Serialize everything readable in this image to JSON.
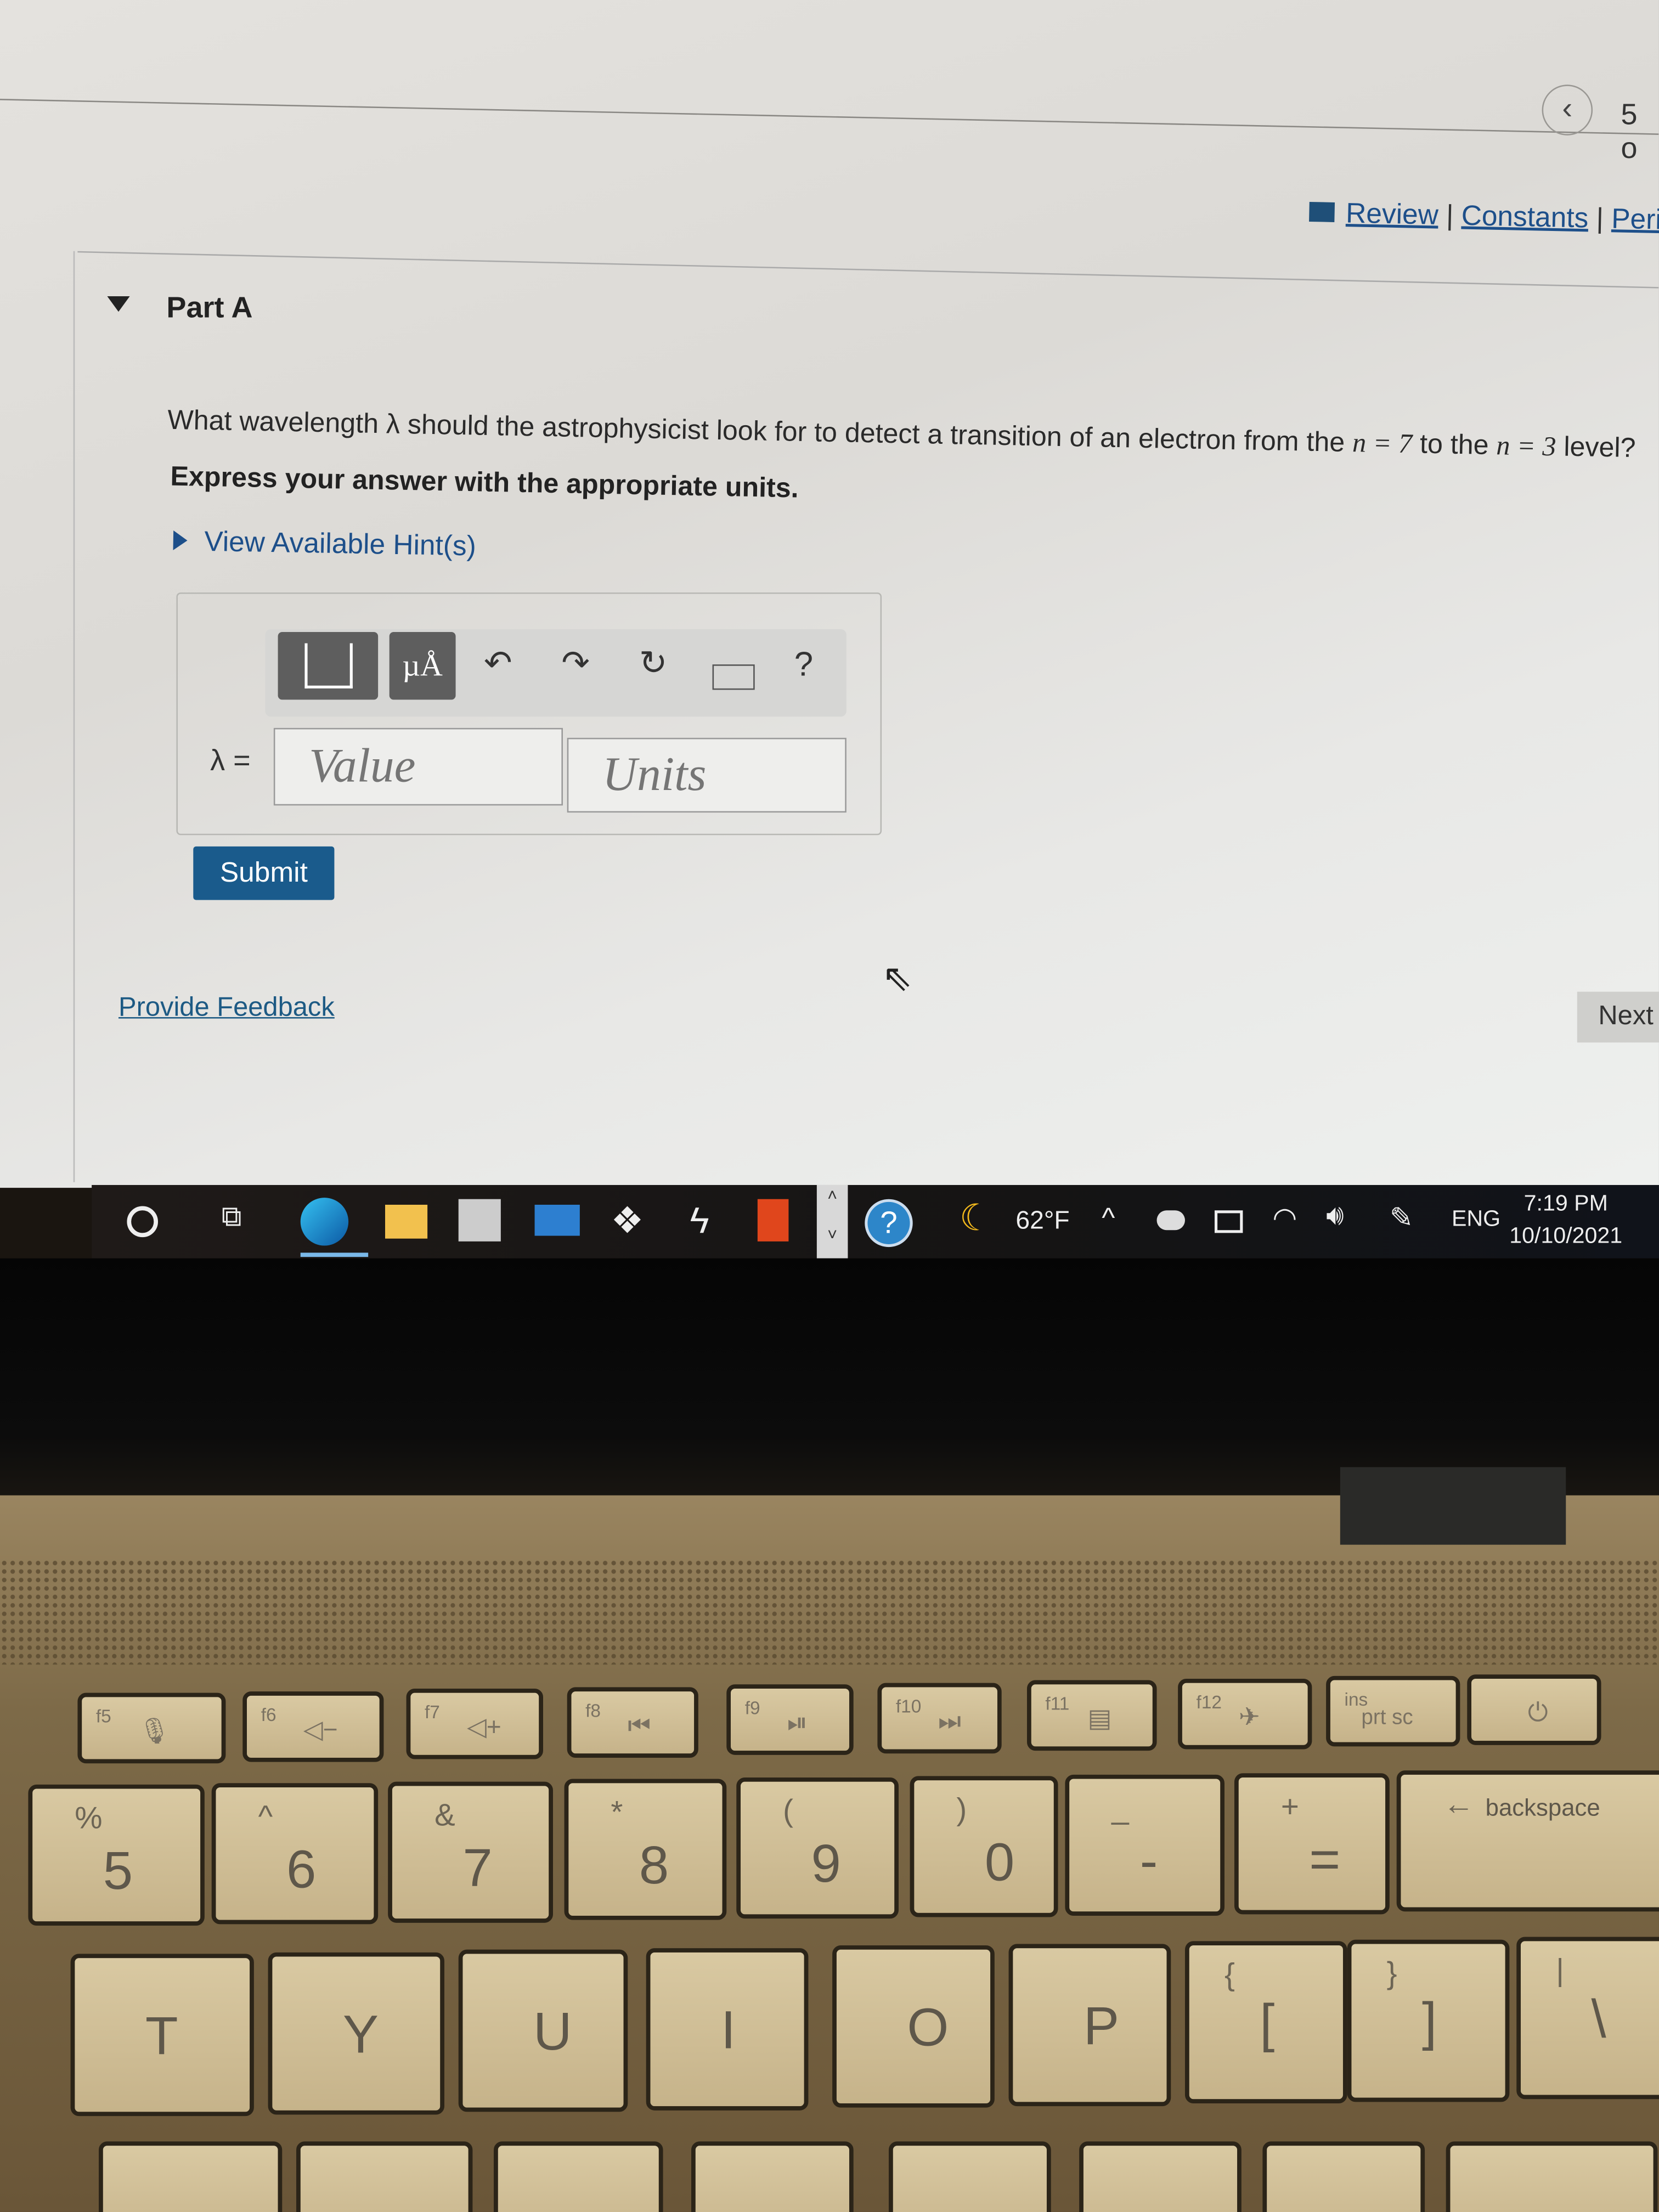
{
  "header": {
    "back_icon": "chevron-left-icon",
    "page_counter": "5 o"
  },
  "resources": {
    "icon": "book-icon",
    "links": [
      "Review",
      "Constants",
      "Periodi"
    ],
    "separator": "|"
  },
  "part": {
    "title": "Part A",
    "toggle_icon": "triangle-down-icon"
  },
  "question": {
    "text_before": "What wavelength λ should the astrophysicist look for to detect a transition of an electron from the ",
    "n1": "n = 7",
    "middle": " to the ",
    "n2": "n = 3",
    "text_after": " level?",
    "instruction": "Express your answer with the appropriate units.",
    "hint_link": "View Available Hint(s)"
  },
  "answer": {
    "toolbar": {
      "templates_icon": "templates-icon",
      "units_label": "µÅ",
      "undo_icon": "undo-icon",
      "redo_icon": "redo-icon",
      "reset_icon": "reset-icon",
      "keyboard_icon": "keyboard-icon",
      "help_label": "?"
    },
    "variable_label": "λ =",
    "value_placeholder": "Value",
    "units_placeholder": "Units",
    "submit_label": "Submit"
  },
  "footer": {
    "feedback_link": "Provide Feedback",
    "next_label": "Next"
  },
  "taskbar": {
    "apps": [
      "cortana-icon",
      "task-view-icon",
      "edge-icon",
      "file-explorer-icon",
      "store-icon",
      "mail-icon",
      "dropbox-icon",
      "bolt-icon",
      "office-icon",
      "help-icon"
    ],
    "weather": "62°F",
    "language": "ENG",
    "time": "7:19 PM",
    "date": "10/10/2021"
  },
  "keyboard": {
    "fn_row": [
      {
        "fn": "f5",
        "icon": "mic-mute-icon"
      },
      {
        "fn": "f6",
        "icon": "volume-down-icon"
      },
      {
        "fn": "f7",
        "icon": "volume-up-icon"
      },
      {
        "fn": "f8",
        "icon": "previous-track-icon"
      },
      {
        "fn": "f9",
        "icon": "play-pause-icon"
      },
      {
        "fn": "f10",
        "icon": "next-track-icon"
      },
      {
        "fn": "f11",
        "icon": "keyboard-light-icon"
      },
      {
        "fn": "f12",
        "icon": "airplane-icon"
      },
      {
        "fn": "ins",
        "label": "prt sc"
      },
      {
        "fn": "",
        "icon": "power-icon"
      }
    ],
    "number_row": [
      {
        "top": "%",
        "main": "5"
      },
      {
        "top": "^",
        "main": "6"
      },
      {
        "top": "&",
        "main": "7"
      },
      {
        "top": "*",
        "main": "8"
      },
      {
        "top": "(",
        "main": "9"
      },
      {
        "top": ")",
        "main": "0"
      },
      {
        "top": "_",
        "main": "-"
      },
      {
        "top": "+",
        "main": "="
      },
      {
        "top": "←",
        "main": "backspace"
      }
    ],
    "letter_row": [
      {
        "main": "T"
      },
      {
        "main": "Y"
      },
      {
        "main": "U"
      },
      {
        "main": "I"
      },
      {
        "main": "O"
      },
      {
        "main": "P"
      },
      {
        "top": "{",
        "main": "["
      },
      {
        "top": "}",
        "main": "]"
      },
      {
        "top": "|",
        "main": "\\"
      }
    ]
  }
}
